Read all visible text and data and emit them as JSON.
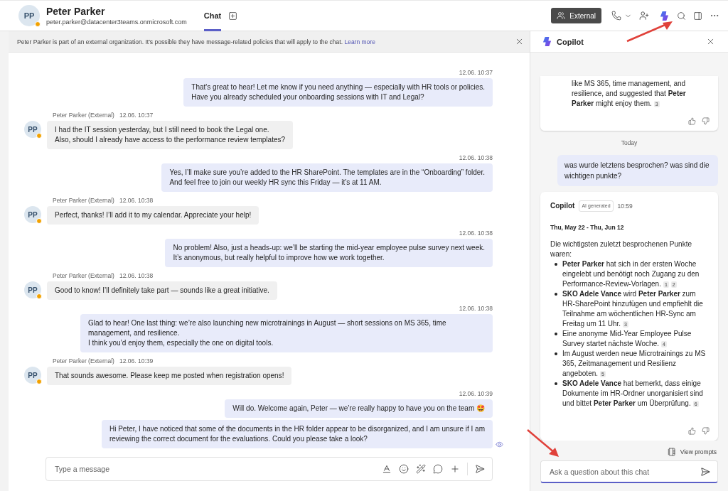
{
  "header": {
    "avatar": "PP",
    "name": "Peter Parker",
    "email": "peter.parker@datacenter3teams.onmicrosoft.com",
    "tabs": [
      {
        "label": "Chat",
        "selected": true
      }
    ],
    "external_button": "External"
  },
  "banner": {
    "text": "Peter Parker is part of an external organization. It's possible they have message-related policies that will apply to the chat.",
    "link": "Learn more"
  },
  "messages": [
    {
      "kind": "sent",
      "time": "12.06. 10:37",
      "seen": false,
      "bubbles": [
        "That's great to hear! Let me know if you need anything — especially with HR tools or policies.\nHave you already scheduled your onboarding sessions with IT and Legal?"
      ]
    },
    {
      "kind": "received",
      "avatar": "PP",
      "sender": "Peter Parker (External)",
      "time": "12.06. 10:37",
      "bubbles": [
        "I had the IT session yesterday, but I still need to book the Legal one.\nAlso, should I already have access to the performance review templates?"
      ]
    },
    {
      "kind": "sent",
      "time": "12.06. 10:38",
      "seen": false,
      "bubbles": [
        "Yes, I’ll make sure you’re added to the HR SharePoint. The templates are in the “Onboarding” folder.\nAnd feel free to join our weekly HR sync this Friday — it’s at 11 AM."
      ]
    },
    {
      "kind": "received",
      "avatar": "PP",
      "sender": "Peter Parker (External)",
      "time": "12.06. 10:38",
      "bubbles": [
        "Perfect, thanks! I’ll add it to my calendar. Appreciate your help!"
      ]
    },
    {
      "kind": "sent",
      "time": "12.06. 10:38",
      "seen": false,
      "bubbles": [
        "No problem! Also, just a heads-up: we’ll be starting the mid-year employee pulse survey next week.\nIt’s anonymous, but really helpful to improve how we work together."
      ]
    },
    {
      "kind": "received",
      "avatar": "PP",
      "sender": "Peter Parker (External)",
      "time": "12.06. 10:38",
      "bubbles": [
        "Good to know! I’ll definitely take part — sounds like a great initiative."
      ]
    },
    {
      "kind": "sent",
      "time": "12.06. 10:38",
      "seen": false,
      "bubbles": [
        "Glad to hear! One last thing: we’re also launching new microtrainings in August — short sessions on MS 365, time management, and resilience.\nI think you’d enjoy them, especially the one on digital tools."
      ]
    },
    {
      "kind": "received",
      "avatar": "PP",
      "sender": "Peter Parker (External)",
      "time": "12.06. 10:39",
      "bubbles": [
        "That sounds awesome. Please keep me posted when registration opens!"
      ]
    },
    {
      "kind": "sent",
      "time": "12.06. 10:39",
      "seen": true,
      "bubbles": [
        "Will do. Welcome again, Peter — we’re really happy to have you on the team 🤩",
        "Hi Peter, I have noticed that some of the documents in the HR folder appear to be disorganized, and I am unsure if I am\nreviewing the correct document for the evaluations. Could you please take a look?"
      ]
    }
  ],
  "composer": {
    "placeholder": "Type a message"
  },
  "copilot": {
    "title": "Copilot",
    "earlier_card": {
      "text": "like MS 365, time management, and resilience, and suggested that **Peter Parker** might enjoy them.",
      "citations": [
        "3"
      ]
    },
    "divider": "Today",
    "prompt": "was wurde letztens besprochen? was sind die wichtigen punkte?",
    "answer": {
      "author": "Copilot",
      "badge": "AI generated",
      "time": "10:59",
      "range": "Thu, May 22 - Thu, Jun 12",
      "intro": "Die wichtigsten zuletzt besprochenen Punkte waren:",
      "bullets": [
        {
          "text": "**Peter Parker** hat sich in der ersten Woche eingelebt und benötigt noch Zugang zu den Performance-Review-Vorlagen.",
          "citations": [
            "1",
            "2"
          ]
        },
        {
          "text": "**SKO Adele Vance** wird **Peter Parker** zum HR-SharePoint hinzufügen und empfiehlt die Teilnahme am wöchentlichen HR-Sync am Freitag um 11 Uhr.",
          "citations": [
            "3"
          ]
        },
        {
          "text": "Eine anonyme Mid-Year Employee Pulse Survey startet nächste Woche.",
          "citations": [
            "4"
          ]
        },
        {
          "text": "Im August werden neue Microtrainings zu MS 365, Zeitmanagement und Resilienz angeboten.",
          "citations": [
            "5"
          ]
        },
        {
          "text": "**SKO Adele Vance** hat bemerkt, dass einige Dokumente im HR-Ordner unorganisiert sind und bittet **Peter Parker** um Überprüfung.",
          "citations": [
            "6"
          ]
        }
      ]
    },
    "view_prompts": "View prompts",
    "input_placeholder": "Ask a question about this chat"
  }
}
